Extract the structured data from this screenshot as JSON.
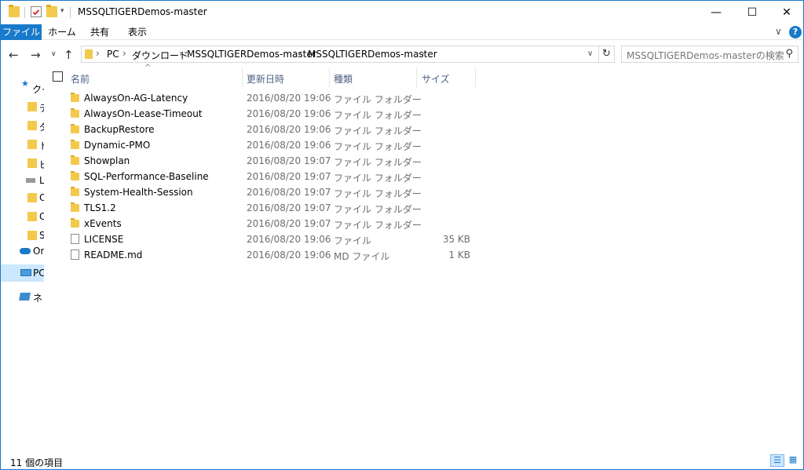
{
  "window": {
    "title": "MSSQLTIGERDemos-master",
    "controls": {
      "minimize": "—",
      "maximize": "☐",
      "close": "✕"
    }
  },
  "ribbon": {
    "tabs": [
      {
        "label": "ファイル",
        "active": true
      },
      {
        "label": "ホーム"
      },
      {
        "label": "共有"
      },
      {
        "label": "表示"
      }
    ],
    "expand_glyph": "∨",
    "help_glyph": "?"
  },
  "address": {
    "breadcrumbs": [
      "PC",
      "ダウンロード",
      "MSSQLTIGERDemos-master",
      "MSSQLTIGERDemos-master"
    ],
    "search_placeholder": "MSSQLTIGERDemos-masterの検索"
  },
  "navpane": {
    "items": [
      {
        "label": "クイ",
        "icon": "star-icon"
      },
      {
        "label": "デ",
        "icon": "folder-icon"
      },
      {
        "label": "ダ",
        "icon": "folder-icon"
      },
      {
        "label": "ド",
        "icon": "folder-icon"
      },
      {
        "label": "ピ",
        "icon": "folder-icon"
      },
      {
        "label": "L",
        "icon": "drive-icon"
      },
      {
        "label": "C",
        "icon": "folder-icon"
      },
      {
        "label": "C",
        "icon": "folder-icon"
      },
      {
        "label": "S",
        "icon": "folder-icon"
      },
      {
        "label": "On",
        "icon": "cloud-icon"
      },
      {
        "label": "PC",
        "icon": "pc-icon",
        "selected": true
      },
      {
        "label": "ネ",
        "icon": "network-icon"
      }
    ]
  },
  "columns": {
    "name": "名前",
    "date": "更新日時",
    "type": "種類",
    "size": "サイズ"
  },
  "files": [
    {
      "name": "AlwaysOn-AG-Latency",
      "date": "2016/08/20 19:06",
      "type": "ファイル フォルダー",
      "size": "",
      "kind": "folder"
    },
    {
      "name": "AlwaysOn-Lease-Timeout",
      "date": "2016/08/20 19:06",
      "type": "ファイル フォルダー",
      "size": "",
      "kind": "folder"
    },
    {
      "name": "BackupRestore",
      "date": "2016/08/20 19:06",
      "type": "ファイル フォルダー",
      "size": "",
      "kind": "folder"
    },
    {
      "name": "Dynamic-PMO",
      "date": "2016/08/20 19:06",
      "type": "ファイル フォルダー",
      "size": "",
      "kind": "folder"
    },
    {
      "name": "Showplan",
      "date": "2016/08/20 19:07",
      "type": "ファイル フォルダー",
      "size": "",
      "kind": "folder"
    },
    {
      "name": "SQL-Performance-Baseline",
      "date": "2016/08/20 19:07",
      "type": "ファイル フォルダー",
      "size": "",
      "kind": "folder"
    },
    {
      "name": "System-Health-Session",
      "date": "2016/08/20 19:07",
      "type": "ファイル フォルダー",
      "size": "",
      "kind": "folder"
    },
    {
      "name": "TLS1.2",
      "date": "2016/08/20 19:07",
      "type": "ファイル フォルダー",
      "size": "",
      "kind": "folder"
    },
    {
      "name": "xEvents",
      "date": "2016/08/20 19:07",
      "type": "ファイル フォルダー",
      "size": "",
      "kind": "folder"
    },
    {
      "name": "LICENSE",
      "date": "2016/08/20 19:06",
      "type": "ファイル",
      "size": "35 KB",
      "kind": "file"
    },
    {
      "name": "README.md",
      "date": "2016/08/20 19:06",
      "type": "MD ファイル",
      "size": "1 KB",
      "kind": "file"
    }
  ],
  "status": {
    "item_count": "11 個の項目"
  },
  "colors": {
    "accent": "#1979ca",
    "folder": "#f3c94c",
    "selected": "#cce8ff"
  }
}
